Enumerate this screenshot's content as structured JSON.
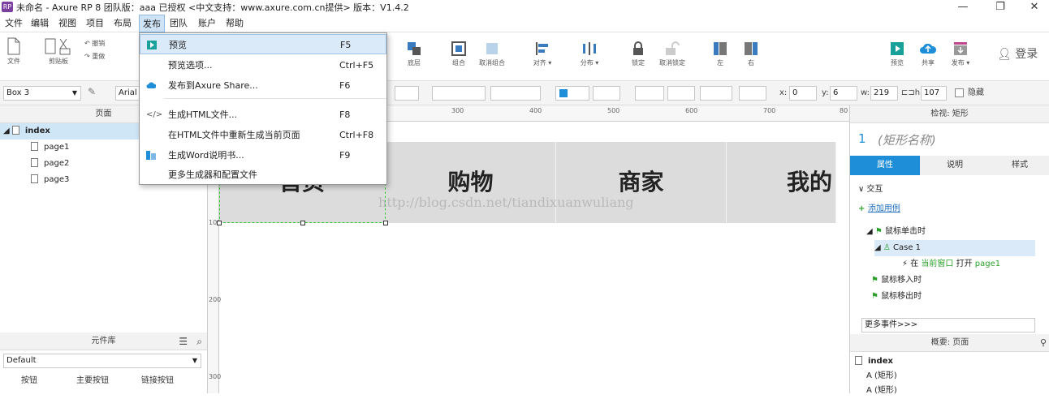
{
  "title_bar": {
    "app_icon_text": "RP",
    "title": "未命名 - Axure RP 8 团队版：aaa 已授权     <中文支持：www.axure.com.cn提供> 版本：V1.4.2",
    "minimize": "—",
    "restore": "❐",
    "close": "✕"
  },
  "menu": {
    "items": [
      "文件",
      "编辑",
      "视图",
      "项目",
      "布局",
      "发布",
      "团队",
      "账户",
      "帮助"
    ],
    "active_index": 5
  },
  "publish_menu": {
    "items": [
      {
        "label": "预览",
        "shortcut": "F5",
        "icon": "preview-icon"
      },
      {
        "label": "预览选项...",
        "shortcut": "Ctrl+F5",
        "icon": ""
      },
      {
        "label": "发布到Axure Share...",
        "shortcut": "F6",
        "icon": "cloud-upload-icon"
      },
      {
        "label": "生成HTML文件...",
        "shortcut": "F8",
        "icon": "code-icon"
      },
      {
        "label": "在HTML文件中重新生成当前页面",
        "shortcut": "Ctrl+F8",
        "icon": ""
      },
      {
        "label": "生成Word说明书...",
        "shortcut": "F9",
        "icon": "word-doc-icon"
      },
      {
        "label": "更多生成器和配置文件",
        "shortcut": "",
        "icon": ""
      }
    ]
  },
  "toolbar": {
    "left_groups": {
      "file": "文件",
      "clipboard": "剪贴板",
      "undo": "撤销",
      "redo": "重做"
    },
    "buttons": [
      {
        "label": "底层",
        "icon": "send-back-icon"
      },
      {
        "label": "组合",
        "icon": "group-icon"
      },
      {
        "label": "取消组合",
        "icon": "ungroup-icon"
      },
      {
        "label": "对齐 ▾",
        "icon": "align-icon"
      },
      {
        "label": "分布 ▾",
        "icon": "distribute-icon"
      },
      {
        "label": "锁定",
        "icon": "lock-icon"
      },
      {
        "label": "取消锁定",
        "icon": "unlock-icon"
      },
      {
        "label": "左",
        "icon": "left-panel-icon"
      },
      {
        "label": "右",
        "icon": "right-panel-icon"
      }
    ],
    "right_buttons": [
      {
        "label": "预览",
        "icon": "preview-icon"
      },
      {
        "label": "共享",
        "icon": "share-icon"
      },
      {
        "label": "发布 ▾",
        "icon": "publish-icon"
      }
    ],
    "login": "登录"
  },
  "format_bar": {
    "widget_select": "Box 3",
    "font": "Arial",
    "x_label": "x:",
    "x_value": "0",
    "y_label": "y:",
    "y_value": "6",
    "w_label": "w:",
    "w_value": "219",
    "h_label": "h:",
    "h_value": "107",
    "hidden_label": "隐藏"
  },
  "pages_panel": {
    "title": "页面",
    "root": "index",
    "pages": [
      "page1",
      "page2",
      "page3"
    ]
  },
  "library_panel": {
    "title": "元件库",
    "selected": "Default",
    "items": [
      "按钮",
      "主要按钮",
      "链接按钮"
    ]
  },
  "canvas": {
    "ruler_top": [
      "300",
      "400",
      "500",
      "600",
      "700",
      "80"
    ],
    "ruler_left": [
      "100",
      "200",
      "300"
    ],
    "nav_items": [
      "首页",
      "购物",
      "商家",
      "我的"
    ],
    "watermark": "http://blog.csdn.net/tiandixuanwuliang"
  },
  "inspector": {
    "title": "检视: 矩形",
    "number": "1",
    "shape_name_placeholder": "(矩形名称)",
    "tabs": [
      "属性",
      "说明",
      "样式"
    ],
    "interaction_label": "交互",
    "add_case": "添加用例",
    "events": {
      "on_click": "鼠标单击时",
      "case": "Case 1",
      "action_prefix": "在",
      "action_target": "当前窗口",
      "action_verb": "打开",
      "action_page": "page1",
      "mouse_enter": "鼠标移入时",
      "mouse_leave": "鼠标移出时"
    },
    "more_events": "更多事件>>>"
  },
  "outline_panel": {
    "title": "概要: 页面",
    "root": "index",
    "items": [
      "(矩形)",
      "(矩形)"
    ]
  },
  "colors": {
    "accent": "#1f8ed9",
    "green": "#2aa02a",
    "menu_highlight": "#dbeaf8"
  }
}
